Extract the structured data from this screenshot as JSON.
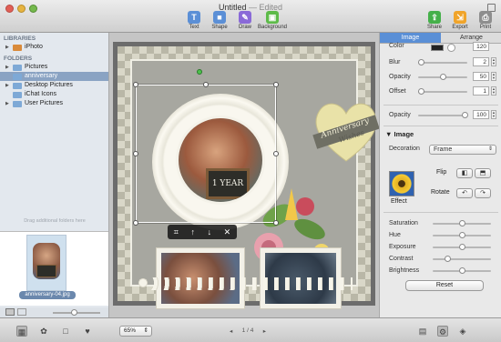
{
  "window": {
    "title": "Untitled",
    "status": "Edited"
  },
  "toolbar": [
    {
      "label": "Text",
      "color": "#5b8fd6",
      "glyph": "T"
    },
    {
      "label": "Shape",
      "color": "#5b8fd6",
      "glyph": "■"
    },
    {
      "label": "Draw",
      "color": "#8a6ad8",
      "glyph": "✎"
    },
    {
      "label": "Background",
      "color": "#5dbb49",
      "glyph": "▣"
    },
    {
      "label": "Share",
      "color": "#45b04a",
      "glyph": "⇪"
    },
    {
      "label": "Export",
      "color": "#f0a42a",
      "glyph": "⇲"
    },
    {
      "label": "Print",
      "color": "#8e8e8e",
      "glyph": "⎙"
    }
  ],
  "sidebar": {
    "libraries_header": "LIBRARIES",
    "libraries": [
      {
        "label": "iPhoto"
      }
    ],
    "folders_header": "FOLDERS",
    "folders": [
      {
        "label": "Pictures"
      },
      {
        "label": "anniversary",
        "selected": true
      },
      {
        "label": "Desktop Pictures"
      },
      {
        "label": "iChat Icons"
      },
      {
        "label": "User Pictures"
      }
    ],
    "drag_hint": "Drag additional folders here",
    "thumbnail_caption": "anniversary-04.jpg"
  },
  "canvas": {
    "chalkboard_text": "1 YEAR",
    "heart_text_line1": "Anniversary",
    "heart_text_line2": "Wishes",
    "selection_tools": [
      "⌗",
      "↑",
      "↓",
      "✕"
    ]
  },
  "inspector": {
    "tabs": [
      {
        "label": "Image",
        "active": true
      },
      {
        "label": "Arrange",
        "active": false
      }
    ],
    "color_label": "Color",
    "color_value": "120",
    "blur_label": "Blur",
    "blur_value": "2",
    "opacity_label": "Opacity",
    "opacity_value": "50",
    "offset_label": "Offset",
    "offset_value": "1",
    "opacity2_label": "Opacity",
    "opacity2_value": "100",
    "image_section": "Image",
    "decoration_label": "Decoration",
    "decoration_value": "Frame",
    "effect_label": "Effect",
    "flip_label": "Flip",
    "rotate_label": "Rotate",
    "adjustments": [
      {
        "label": "Saturation",
        "level": 0.45
      },
      {
        "label": "Hue",
        "level": 0.45
      },
      {
        "label": "Exposure",
        "level": 0.45
      },
      {
        "label": "Contrast",
        "level": 0.2
      },
      {
        "label": "Brightness",
        "level": 0.45
      }
    ],
    "reset_label": "Reset"
  },
  "bottombar": {
    "zoom": "65%",
    "page": "1 / 4"
  }
}
